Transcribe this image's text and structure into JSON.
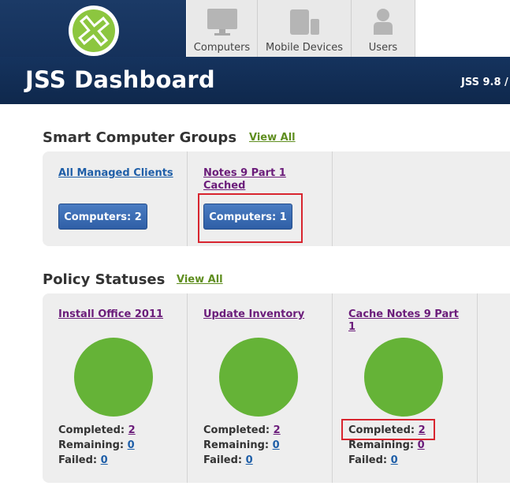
{
  "header": {
    "title": "JSS Dashboard",
    "version": "JSS 9.8 /",
    "nav": [
      {
        "label": "Computers",
        "icon": "monitor-icon"
      },
      {
        "label": "Mobile Devices",
        "icon": "mobile-devices-icon"
      },
      {
        "label": "Users",
        "icon": "user-icon"
      }
    ]
  },
  "colors": {
    "accent_green": "#65b337",
    "link_blue": "#1f5fa8",
    "link_visited": "#6b1c7a",
    "header_navy": "#14305a",
    "highlight_red": "#d8252f"
  },
  "smart_groups": {
    "title": "Smart Computer Groups",
    "view_all": "View All",
    "items": [
      {
        "name": "All Managed Clients",
        "button": "Computers: 2"
      },
      {
        "name": "Notes 9 Part 1 Cached",
        "button": "Computers: 1"
      }
    ]
  },
  "policy_statuses": {
    "title": "Policy Statuses",
    "view_all": "View All",
    "completed_label": "Completed:",
    "remaining_label": "Remaining:",
    "failed_label": "Failed:",
    "items": [
      {
        "name": "Install Office 2011",
        "completed": "2",
        "remaining": "0",
        "failed": "0"
      },
      {
        "name": "Update Inventory",
        "completed": "2",
        "remaining": "0",
        "failed": "0"
      },
      {
        "name": "Cache Notes 9 Part 1",
        "completed": "2",
        "remaining": "0",
        "failed": "0"
      }
    ]
  }
}
